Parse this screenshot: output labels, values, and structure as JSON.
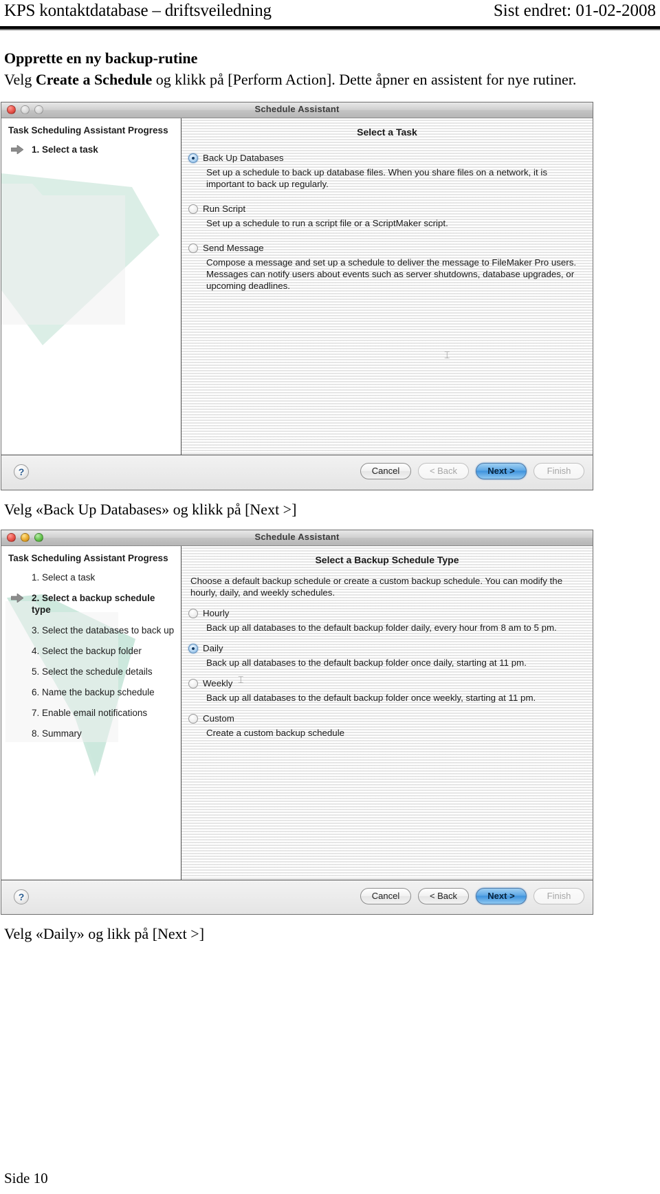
{
  "header": {
    "left": "KPS kontaktdatabase – driftsveiledning",
    "right": "Sist endret: 01-02-2008"
  },
  "doc": {
    "heading": "Opprette en ny backup-rutine",
    "intro_prefix": "Velg ",
    "intro_bold": "Create a Schedule",
    "intro_suffix": " og klikk på [Perform Action]. Dette åpner en assistent for nye rutiner.",
    "caption1": "Velg «Back Up Databases» og klikk på [Next >]",
    "caption2": "Velg «Daily» og likk på [Next >]",
    "page_number": "Side 10"
  },
  "window1": {
    "title": "Schedule Assistant",
    "traffic": {
      "close": "close-button",
      "minimize": "minimize-button",
      "zoom": "zoom-button"
    },
    "progress": {
      "title": "Task Scheduling Assistant Progress",
      "steps": [
        {
          "label": "1. Select a task",
          "current": true
        }
      ]
    },
    "pane_title": "Select a Task",
    "options": [
      {
        "label": "Back Up Databases",
        "selected": true,
        "desc": "Set up a schedule to back up database files. When you share files on a network, it is important to back up regularly."
      },
      {
        "label": "Run Script",
        "selected": false,
        "desc": "Set up a schedule to run a script file or a ScriptMaker script."
      },
      {
        "label": "Send Message",
        "selected": false,
        "desc": "Compose a message and set up a schedule to deliver the message to FileMaker Pro users. Messages can notify users about events such as server shutdowns, database upgrades, or upcoming deadlines."
      }
    ],
    "footer": {
      "help": "?",
      "cancel": "Cancel",
      "back": "< Back",
      "next": "Next >",
      "finish": "Finish"
    }
  },
  "window2": {
    "title": "Schedule Assistant",
    "progress": {
      "title": "Task Scheduling Assistant Progress",
      "steps": [
        {
          "label": "1. Select a task",
          "current": false
        },
        {
          "label": "2. Select a backup schedule type",
          "current": true
        },
        {
          "label": "3. Select the databases to back up",
          "current": false
        },
        {
          "label": "4. Select the backup folder",
          "current": false
        },
        {
          "label": "5. Select the schedule details",
          "current": false
        },
        {
          "label": "6. Name the backup schedule",
          "current": false
        },
        {
          "label": "7. Enable email notifications",
          "current": false
        },
        {
          "label": "8. Summary",
          "current": false
        }
      ]
    },
    "pane_title": "Select a Backup Schedule Type",
    "intro": "Choose a default backup schedule or create a custom backup schedule. You can modify the hourly, daily, and weekly schedules.",
    "options": [
      {
        "label": "Hourly",
        "selected": false,
        "desc": "Back up all databases to the default backup folder daily, every hour from 8 am to 5 pm."
      },
      {
        "label": "Daily",
        "selected": true,
        "desc": "Back up all databases to the default backup folder once daily, starting at 11 pm."
      },
      {
        "label": "Weekly",
        "selected": false,
        "desc": "Back up all databases to the default backup folder once weekly, starting at 11 pm."
      },
      {
        "label": "Custom",
        "selected": false,
        "desc": "Create a custom backup schedule"
      }
    ],
    "footer": {
      "help": "?",
      "cancel": "Cancel",
      "back": "< Back",
      "next": "Next >",
      "finish": "Finish"
    }
  },
  "colors": {
    "accent_blue": "#3f93dd",
    "watermark_green": "#cbe8dc"
  }
}
